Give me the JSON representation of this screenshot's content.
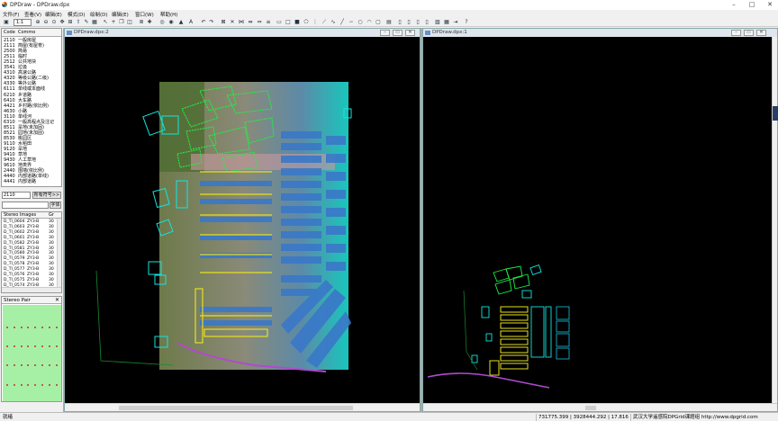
{
  "app": {
    "title": "DPDraw - DPDraw.dpx"
  },
  "window_controls": {
    "minimize": "–",
    "maximize": "□",
    "close": "✕"
  },
  "menu": [
    "文件(F)",
    "查看(V)",
    "编辑(E)",
    "模式(D)",
    "绘制(D)",
    "编辑(E)",
    "窗口(W)",
    "帮助(H)"
  ],
  "toolbar": {
    "zoom_value": "1:1"
  },
  "code_panel": {
    "header_code": "Code",
    "header_name": "Commo",
    "rows": [
      [
        "2110",
        "一般房屋"
      ],
      [
        "2111",
        "简屋(有屋脊)"
      ],
      [
        "2500",
        "简易"
      ],
      [
        "2511",
        "临时"
      ],
      [
        "2512",
        "公共地块"
      ],
      [
        "3541",
        "垃圾"
      ],
      [
        "4310",
        "高速公路"
      ],
      [
        "4320",
        "等级公路(二级)"
      ],
      [
        "4330",
        "等外公路"
      ],
      [
        "6111",
        "单线或本面线"
      ],
      [
        "6210",
        "乡道路"
      ],
      [
        "6410",
        "大车路"
      ],
      [
        "4421",
        "乡村路(依比例)"
      ],
      [
        "4630",
        "小路"
      ],
      [
        "3110",
        "单线河"
      ],
      [
        "6310",
        "一般高程点及注记"
      ],
      [
        "8511",
        "旱地(未加固)"
      ],
      [
        "8521",
        "园地(未加固)"
      ],
      [
        "8530",
        "桃园区"
      ],
      [
        "9110",
        "水稻田"
      ],
      [
        "9120",
        "旱地"
      ],
      [
        "9410",
        "草地"
      ],
      [
        "9430",
        "人工草地"
      ],
      [
        "9610",
        "地类界"
      ],
      [
        "2440",
        "围墙(依比例)"
      ],
      [
        "4440",
        "内部道路(单线)"
      ],
      [
        "4441",
        "内部道路"
      ]
    ],
    "code_input_value": "2110",
    "all_codes_button": "所有符号>>",
    "font_button": "字体"
  },
  "stereo_images": {
    "header": "Stereo Images",
    "header_col": "Gr",
    "rows": [
      [
        "D_TI_0604",
        "ZY3-B",
        "30"
      ],
      [
        "D_TI_0603",
        "ZY3-B",
        "30"
      ],
      [
        "D_TI_0602",
        "ZY3-B",
        "30"
      ],
      [
        "D_TI_0601",
        "ZY3-B",
        "30"
      ],
      [
        "D_TI_0582",
        "ZY3-B",
        "30"
      ],
      [
        "D_TI_0581",
        "ZY3-B",
        "30"
      ],
      [
        "D_TI_0580",
        "ZY3-B",
        "30"
      ],
      [
        "D_TI_0579",
        "ZY3-B",
        "30"
      ],
      [
        "D_TI_0578",
        "ZY3-B",
        "30"
      ],
      [
        "D_TI_0577",
        "ZY3-B",
        "30"
      ],
      [
        "D_TI_0576",
        "ZY3-B",
        "30"
      ],
      [
        "D_TI_0575",
        "ZY3-B",
        "30"
      ],
      [
        "D_TI_0574",
        "ZY3-B",
        "30"
      ],
      [
        "D_TI_0573",
        "ZY3-B",
        "30"
      ]
    ]
  },
  "stereo_pair": {
    "title": "Stereo Pair",
    "close": "✕"
  },
  "doc_windows": [
    {
      "title": "DPDraw.dpx:2"
    },
    {
      "title": "DPDraw.dpx:1"
    }
  ],
  "doc_controls": {
    "minimize": "–",
    "restore": "▭",
    "close": "✕"
  },
  "status": {
    "ready": "就绪",
    "coords": "731775.399 | 3928444.292 | 17.816",
    "copyright": "武汉大学遥感院DPGrid课题组 http://www.dpgrid.com"
  },
  "colors": {
    "vector_green": "#22ee44",
    "vector_cyan": "#11e6e0",
    "vector_yellow": "#e6e020",
    "road_magenta": "#b04ad0"
  }
}
